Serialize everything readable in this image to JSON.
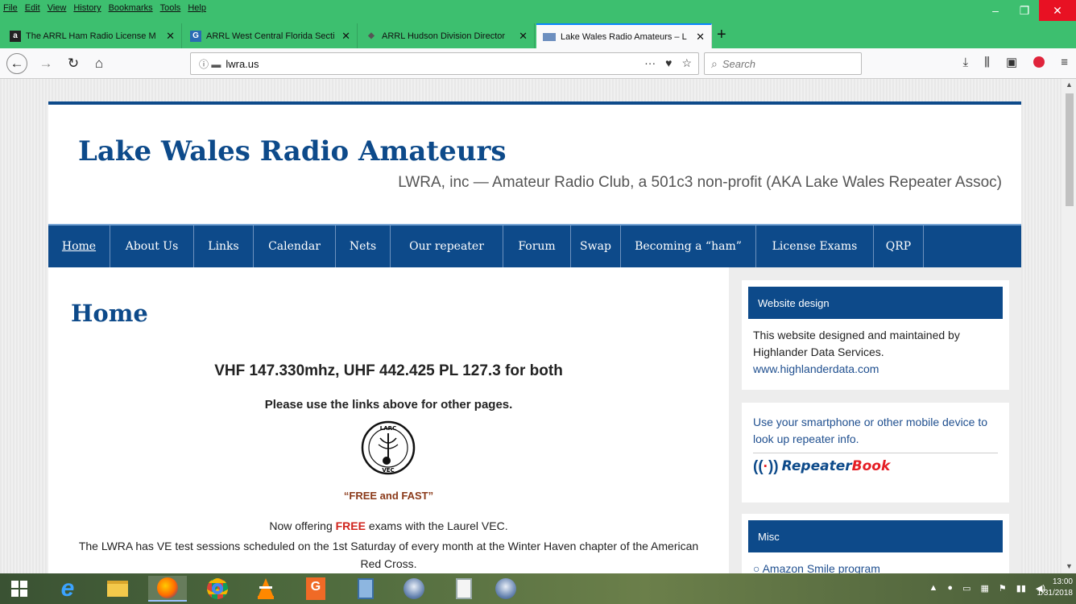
{
  "menubar": {
    "items": [
      "File",
      "Edit",
      "View",
      "History",
      "Bookmarks",
      "Tools",
      "Help"
    ]
  },
  "tabs": [
    {
      "title": "The ARRL Ham Radio License M",
      "favicon": "amazon-icon",
      "color": "#222222"
    },
    {
      "title": "ARRL West Central Florida Secti",
      "favicon": "arrl-icon",
      "color": "#2a6bb4"
    },
    {
      "title": "ARRL Hudson Division Director",
      "favicon": "diamond-icon",
      "color": "#555555"
    },
    {
      "title": "Lake Wales Radio Amateurs – L",
      "favicon": "flag-icon",
      "color": "#6d8fbf"
    }
  ],
  "navbar": {
    "url": "lwra.us",
    "search_placeholder": "Search"
  },
  "site": {
    "title": "Lake Wales Radio Amateurs",
    "description": "LWRA, inc — Amateur Radio Club, a 501c3 non-profit (AKA Lake Wales Repeater Assoc)",
    "nav": [
      "Home",
      "About Us",
      "Links",
      "Calendar",
      "Nets",
      "Our repeater",
      "Forum",
      "Swap",
      "Becoming a “ham”",
      "License Exams",
      "QRP"
    ],
    "brand_color": "#0d4a8a"
  },
  "content": {
    "heading": "Home",
    "line1": "VHF 147.330mhz, UHF 442.425 PL 127.3 for both",
    "line2": "Please use the links above for other pages.",
    "logo_top": "LARC",
    "logo_bottom": "VEC",
    "free_fast": "“FREE and FAST”",
    "offer_pre": "Now offering ",
    "offer_free": "FREE",
    "offer_post": " exams with the Laurel VEC.",
    "sessions": "The LWRA has VE test sessions scheduled on the 1st Saturday of every month at the Winter Haven chapter of the American Red Cross."
  },
  "sidebar": {
    "w1_title": "Website design",
    "w1_text": "This website designed and maintained by Highlander Data Services.",
    "w1_link": "www.highlanderdata.com",
    "w2_text": "Use your smartphone or other mobile device to look up repeater info.",
    "w2_logo_a": "Repeater",
    "w2_logo_b": "Book",
    "w3_title": "Misc",
    "w3_item": "Amazon Smile program"
  },
  "taskbar": {
    "apps": [
      "windows-start-icon",
      "internet-explorer-icon",
      "file-explorer-icon",
      "firefox-icon",
      "chrome-icon",
      "vlc-icon",
      "pdf-tool-icon",
      "calculator-icon",
      "thunderbird-icon",
      "notepad-icon",
      "thunderbird-icon"
    ],
    "time": "13:00",
    "date": "1/31/2018"
  }
}
